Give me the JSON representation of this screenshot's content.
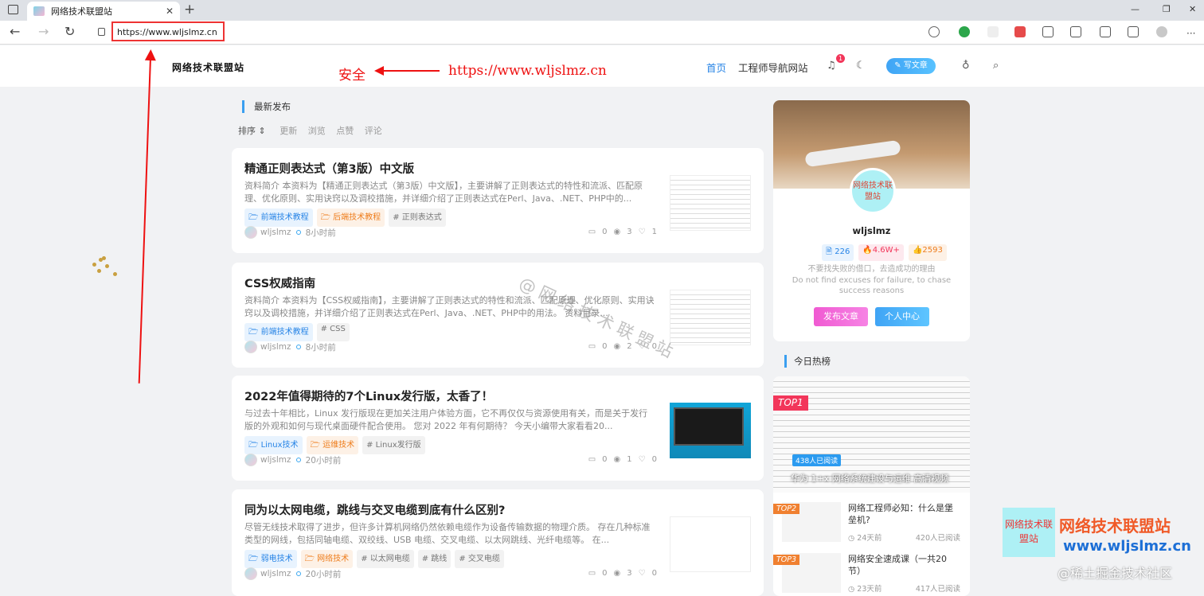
{
  "browser": {
    "tab_title": "网络技术联盟站",
    "tab_close": "✕",
    "new_tab": "+",
    "url": "https://www.wljslmz.cn"
  },
  "header": {
    "logo": "网络技术联盟站",
    "nav": [
      {
        "label": "首页",
        "active": true
      },
      {
        "label": "工程师导航网站",
        "active": false
      }
    ],
    "notification_count": "1",
    "write_button": "✎ 写文章"
  },
  "annotation": {
    "safe_label": "安全",
    "url_label": "https://www.wljslmz.cn"
  },
  "feed": {
    "section_title": "最新发布",
    "sort": {
      "label": "排序 ⇕",
      "options": [
        "更新",
        "浏览",
        "点赞",
        "评论"
      ]
    },
    "posts": [
      {
        "title": "精通正则表达式（第3版）中文版",
        "excerpt": "资料简介 本资料为【精通正则表达式（第3版）中文版】，主要讲解了正则表达式的特性和流派、匹配原理、优化原则、实用诀窍以及调校措施，并详细介绍了正则表达式在Perl、Java、.NET、PHP中的...",
        "tags": [
          {
            "text": "🗁 前端技术教程",
            "style": "blue"
          },
          {
            "text": "🗁 后端技术教程",
            "style": "orange"
          },
          {
            "text": "# 正则表达式",
            "style": "gray"
          }
        ],
        "author": "wljslmz",
        "time": "8小时前",
        "comments": "0",
        "views": "3",
        "likes": "1"
      },
      {
        "title": "CSS权威指南",
        "excerpt": "资料简介 本资料为【CSS权威指南】，主要讲解了正则表达式的特性和流派、匹配原理、优化原则、实用诀窍以及调校措施，并详细介绍了正则表达式在Perl、Java、.NET、PHP中的用法。 资料目录...",
        "tags": [
          {
            "text": "🗁 前端技术教程",
            "style": "blue"
          },
          {
            "text": "# CSS",
            "style": "gray"
          }
        ],
        "author": "wljslmz",
        "time": "8小时前",
        "comments": "0",
        "views": "2",
        "likes": "0"
      },
      {
        "title": "2022年值得期待的7个Linux发行版，太香了！",
        "excerpt": "与过去十年相比，Linux 发行版现在更加关注用户体验方面，它不再仅仅与资源使用有关，而是关于发行版的外观和如何与现代桌面硬件配合使用。 您对 2022 年有何期待？ 今天小编带大家看看20...",
        "tags": [
          {
            "text": "🗁 Linux技术",
            "style": "blue"
          },
          {
            "text": "🗁 运维技术",
            "style": "orange"
          },
          {
            "text": "# Linux发行版",
            "style": "gray"
          }
        ],
        "author": "wljslmz",
        "time": "20小时前",
        "comments": "0",
        "views": "1",
        "likes": "0"
      },
      {
        "title": "同为以太网电缆，跳线与交叉电缆到底有什么区别?",
        "excerpt": "尽管无线技术取得了进步，但许多计算机网络仍然依赖电缆作为设备传输数据的物理介质。 存在几种标准类型的网线，包括同轴电缆、双绞线、USB 电缆、交叉电缆、以太网跳线、光纤电缆等。 在...",
        "tags": [
          {
            "text": "🗁 弱电技术",
            "style": "blue"
          },
          {
            "text": "🗁 网络技术",
            "style": "orange"
          },
          {
            "text": "# 以太网电缆",
            "style": "gray"
          },
          {
            "text": "# 跳线",
            "style": "gray"
          },
          {
            "text": "# 交叉电缆",
            "style": "gray"
          }
        ],
        "author": "wljslmz",
        "time": "20小时前",
        "comments": "0",
        "views": "3",
        "likes": "0"
      }
    ]
  },
  "profile": {
    "avatar_text": "网络技术联盟站",
    "name": "wljslmz",
    "stats": [
      {
        "text": "🗎 226",
        "color": "#2784e6",
        "bg": "#e8f3fe"
      },
      {
        "text": "🔥4.6W+",
        "color": "#f2365a",
        "bg": "#fde9ee"
      },
      {
        "text": "👍2593",
        "color": "#ee7d1c",
        "bg": "#fdf1e6"
      }
    ],
    "motto_cn": "不要找失败的借口，去造成功的理由",
    "motto_en": "Do not find excuses for failure, to chase success reasons",
    "publish_button": "发布文章",
    "center_button": "个人中心"
  },
  "hot": {
    "section_title": "今日热榜",
    "top1": {
      "rank": "TOP1",
      "reads": "438人已阅读",
      "title": "华为 1+x 网络系统建设与运维 高清视频"
    },
    "items": [
      {
        "rank": "TOP2",
        "title": "网络工程师必知：什么是堡垒机?",
        "date": "◷ 24天前",
        "reads": "420人已阅读"
      },
      {
        "rank": "TOP3",
        "title": "网络安全速成课（一共20节）",
        "date": "◷ 23天前",
        "reads": "417人已阅读"
      }
    ]
  },
  "watermark": "@网络技术联盟站",
  "brand": {
    "box": "网络技术联盟站",
    "line1": "网络技术联盟站",
    "line2": "www.wljslmz.cn",
    "juejin": "@稀土掘金技术社区"
  }
}
